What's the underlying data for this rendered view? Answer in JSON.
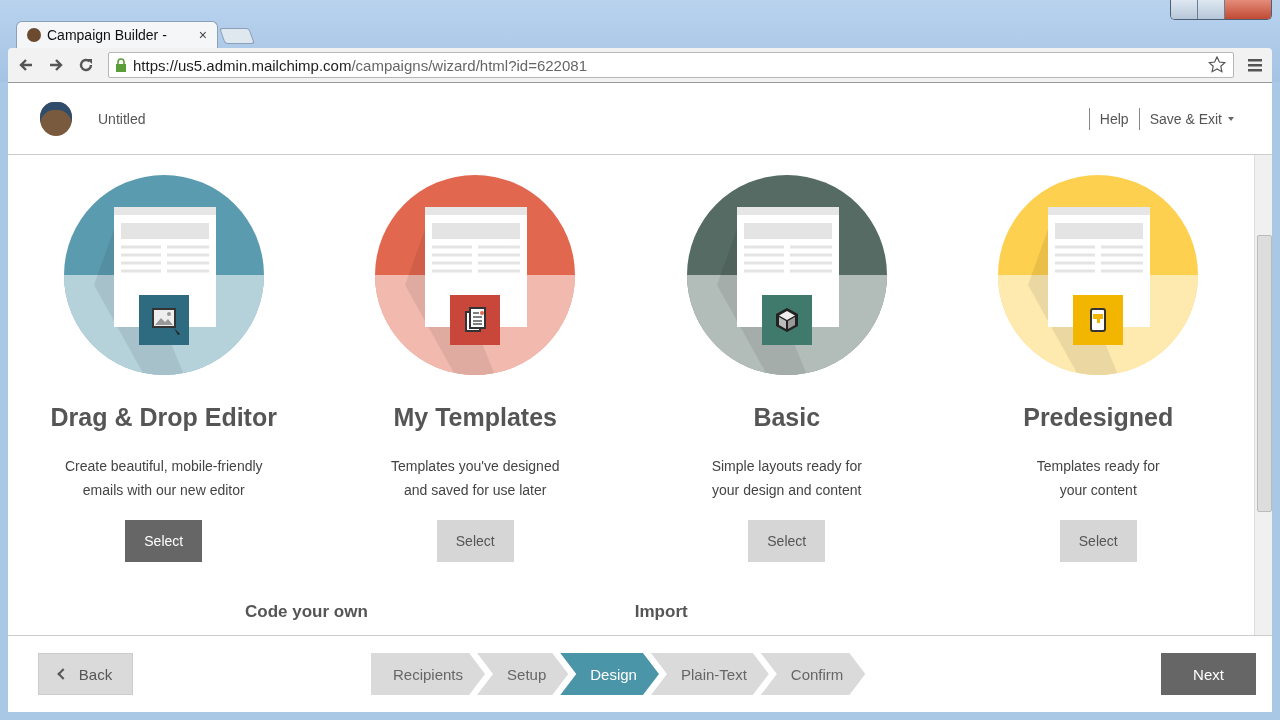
{
  "browser": {
    "tab_title": "Campaign Builder - ",
    "tab_close": "×",
    "url_host": "https://us5.admin.mailchimp.com",
    "url_path": "/campaigns/wizard/html?id=622081"
  },
  "header": {
    "title": "Untitled",
    "links": [
      "Help",
      "Save & Exit"
    ]
  },
  "options": [
    {
      "title": "Drag & Drop Editor",
      "description": [
        "Create beautiful, mobile-friendly",
        "emails with our new editor"
      ],
      "button": "Select",
      "selected": true,
      "kind": "image",
      "color": "#5b9bb0"
    },
    {
      "title": "My Templates",
      "description": [
        "Templates you've designed",
        "and saved for use later"
      ],
      "button": "Select",
      "selected": false,
      "kind": "documents",
      "color": "#e2674f"
    },
    {
      "title": "Basic",
      "description": [
        "Simple layouts ready for",
        "your design and content"
      ],
      "button": "Select",
      "selected": false,
      "kind": "cube",
      "color": "#566b64"
    },
    {
      "title": "Predesigned",
      "description": [
        "Templates ready for",
        "your content"
      ],
      "button": "Select",
      "selected": false,
      "kind": "paint",
      "color": "#fdd04f"
    }
  ],
  "more_options": [
    "Code your own",
    "Import"
  ],
  "footer": {
    "back": "Back",
    "steps": [
      {
        "label": "Recipients",
        "selected": false
      },
      {
        "label": "Setup",
        "selected": false
      },
      {
        "label": "Design",
        "selected": true
      },
      {
        "label": "Plain-Text",
        "selected": false
      },
      {
        "label": "Confirm",
        "selected": false
      }
    ],
    "next": "Next"
  }
}
